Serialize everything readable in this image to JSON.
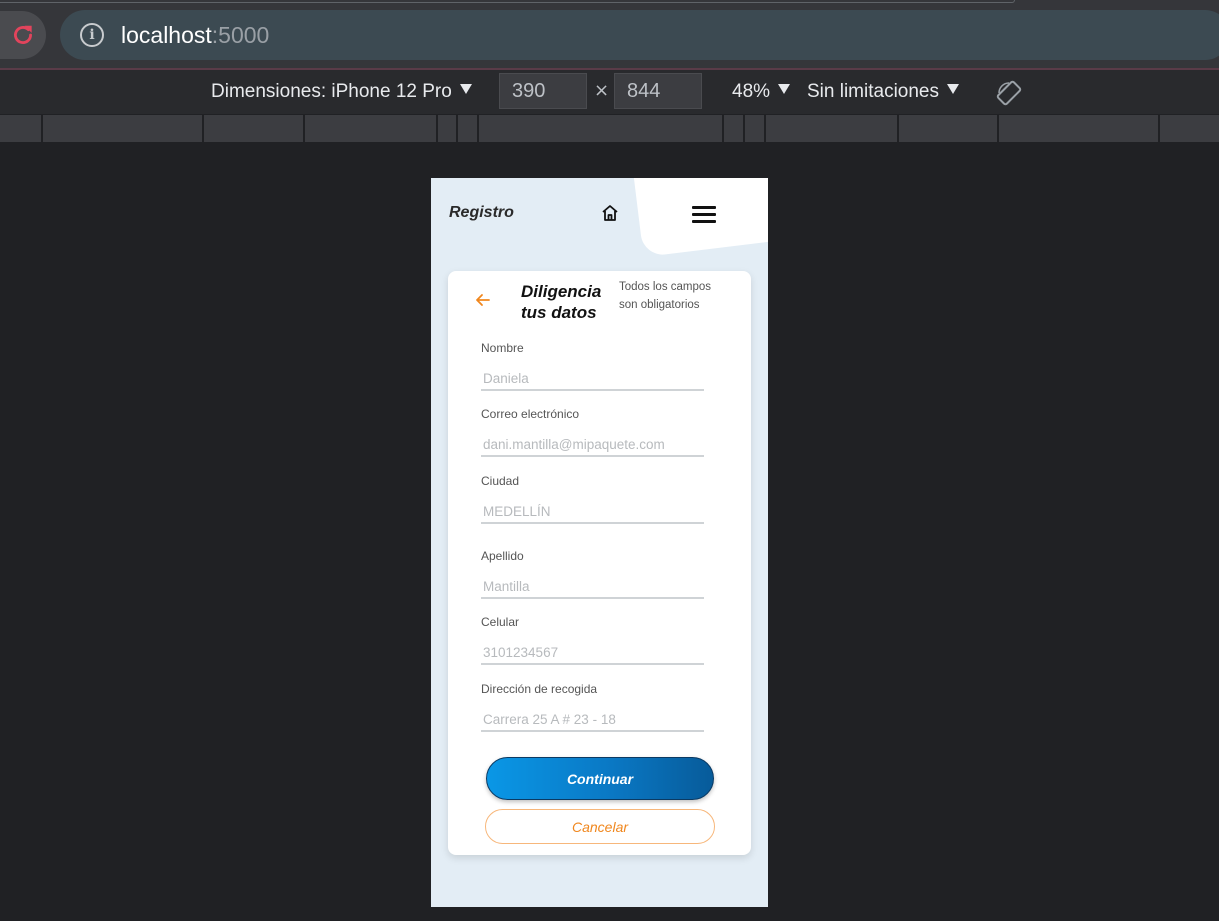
{
  "browser": {
    "url_host": "localhost",
    "url_port": ":5000"
  },
  "device_toolbar": {
    "dimensions_label": "Dimensiones: iPhone 12 Pro",
    "width": "390",
    "height": "844",
    "times": "×",
    "zoom": "48%",
    "throttling": "Sin limitaciones"
  },
  "app": {
    "title": "Registro",
    "form": {
      "heading": "Diligencia\ntus datos",
      "note": "Todos los campos son obligatorios",
      "fields": [
        {
          "label": "Nombre",
          "placeholder": "Daniela"
        },
        {
          "label": "Correo electrónico",
          "placeholder": "dani.mantilla@mipaquete.com"
        },
        {
          "label": "Ciudad",
          "placeholder": "MEDELLÍN"
        },
        {
          "label": "Apellido",
          "placeholder": "Mantilla"
        },
        {
          "label": "Celular",
          "placeholder": "3101234567"
        },
        {
          "label": "Dirección de recogida",
          "placeholder": "Carrera 25 A # 23 - 18"
        }
      ],
      "continue_label": "Continuar",
      "cancel_label": "Cancelar"
    }
  },
  "colors": {
    "accent_blue": "#0a8ad6",
    "accent_orange": "#f0871e",
    "page_bg": "#e3edf5"
  }
}
